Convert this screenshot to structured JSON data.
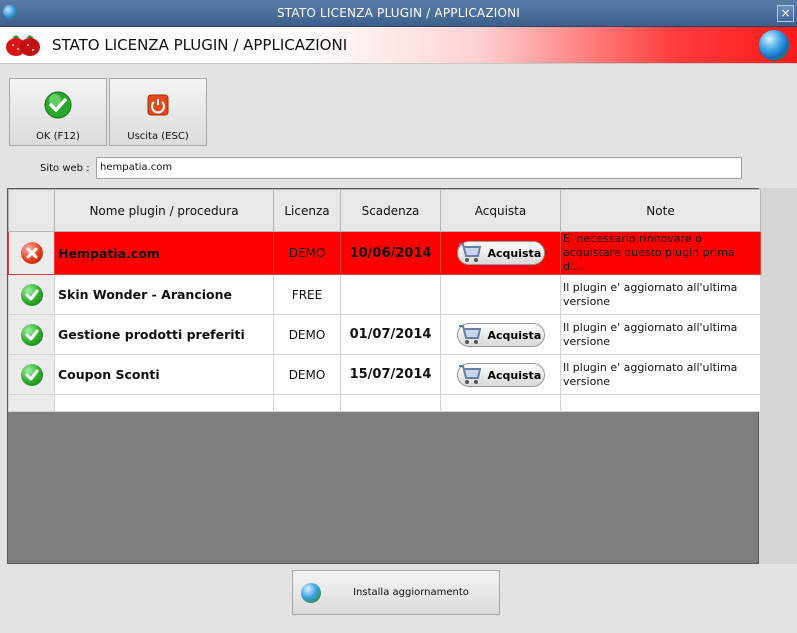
{
  "window": {
    "title": "STATO LICENZA PLUGIN / APPLICAZIONI",
    "close_label": "×"
  },
  "header": {
    "title": "STATO LICENZA PLUGIN / APPLICAZIONI"
  },
  "toolbar": {
    "ok_label": "OK (F12)",
    "exit_label": "Uscita (ESC)"
  },
  "site": {
    "label": "Sito web :",
    "value": "hempatia.com"
  },
  "grid": {
    "columns": [
      "",
      "Nome plugin / procedura",
      "Licenza",
      "Scadenza",
      "Acquista",
      "Note"
    ],
    "rows": [
      {
        "status": "error",
        "name": "Hempatia.com",
        "license": "DEMO",
        "expiry": "10/06/2014",
        "buy": "Acquista",
        "note": "E' necessario rinnovare o acquistare questo plugin prima di..."
      },
      {
        "status": "ok",
        "name": "Skin Wonder - Arancione",
        "license": "FREE",
        "expiry": "",
        "buy": "",
        "note": "Il plugin e' aggiornato all'ultima versione"
      },
      {
        "status": "ok",
        "name": "Gestione prodotti preferiti",
        "license": "DEMO",
        "expiry": "01/07/2014",
        "buy": "Acquista",
        "note": "Il plugin e' aggiornato all'ultima versione"
      },
      {
        "status": "ok",
        "name": "Coupon Sconti",
        "license": "DEMO",
        "expiry": "15/07/2014",
        "buy": "Acquista",
        "note": "Il plugin e' aggiornato all'ultima versione"
      }
    ]
  },
  "install": {
    "label": "Installa aggiornamento"
  },
  "colors": {
    "selected_row": "#ff0000",
    "ok_icon": "#28a828",
    "error_icon": "#e23b1a",
    "header_gradient_end": "#ff1a1a"
  },
  "icons": {
    "app": "globe-icon",
    "logo": "strawberry-icon",
    "ok": "check-circle-icon",
    "exit": "power-icon",
    "buy": "cart-icon",
    "install": "globe-update-icon"
  }
}
